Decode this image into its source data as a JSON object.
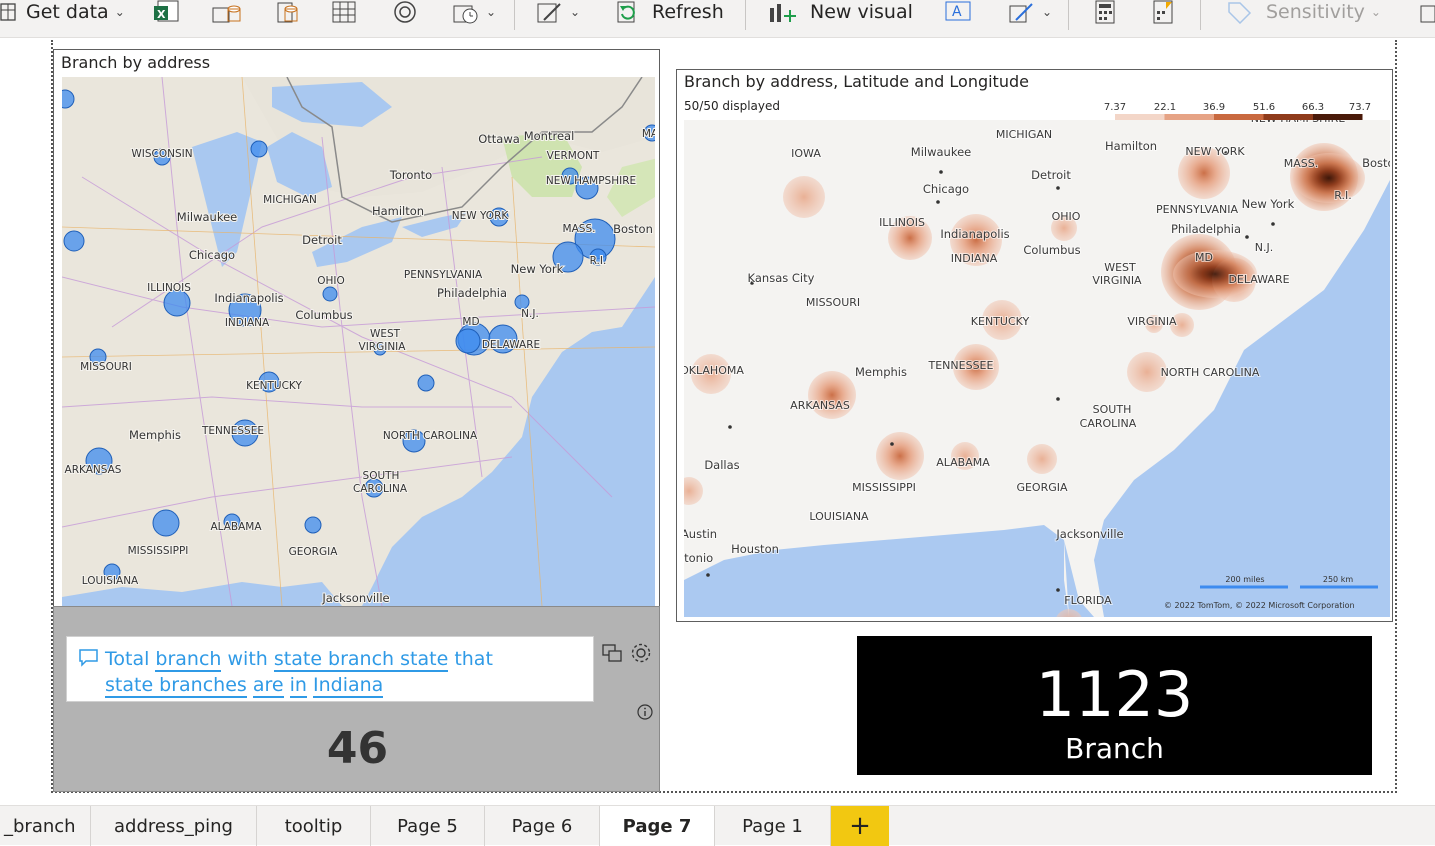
{
  "ribbon": {
    "get_data": "Get data",
    "refresh": "Refresh",
    "new_visual": "New visual",
    "sensitivity": "Sensitivity"
  },
  "visual1": {
    "title": "Branch by address",
    "labels": [
      "WISCONSIN",
      "MICHIGAN",
      "Milwaukee",
      "Chicago",
      "Detroit",
      "Toronto",
      "Hamilton",
      "Ottawa",
      "Montreal",
      "VERMONT",
      "NEW HAMPSHIRE",
      "NEW YORK",
      "MASS.",
      "Boston",
      "R.I.",
      "New York",
      "PENNSYLVANIA",
      "Philadelphia",
      "N.J.",
      "OHIO",
      "Columbus",
      "ILLINOIS",
      "Indianapolis",
      "INDIANA",
      "MISSOURI",
      "WEST",
      "VIRGINIA",
      "KENTUCKY",
      "Memphis",
      "TENNESSEE",
      "NORTH CAROLINA",
      "ARKANSAS",
      "SOUTH",
      "CAROLINA",
      "ALABAMA",
      "MISSISSIPPI",
      "GEORGIA",
      "LOUISIANA",
      "Jacksonville",
      "DELAWARE",
      "MD",
      "MA"
    ]
  },
  "visual2": {
    "title": "Branch by address, Latitude and Longitude",
    "displayed": "50/50 displayed",
    "legend_ticks": [
      "7.37",
      "22.1",
      "36.9",
      "51.6",
      "66.3",
      "73.7"
    ],
    "legend_colors": [
      "#f3d6c8",
      "#e6a385",
      "#c9693f",
      "#8f3b1b",
      "#4a1a0a"
    ],
    "labels": [
      "MICHIGAN",
      "IOWA",
      "Milwaukee",
      "Hamilton",
      "NEW YORK",
      "Boston",
      "Detroit",
      "Chicago",
      "MASS.",
      "R.I.",
      "PENNSYLVANIA",
      "New York",
      "ILLINOIS",
      "OHIO",
      "Philadelphia",
      "Indianapolis",
      "INDIANA",
      "Columbus",
      "N.J.",
      "Kansas City",
      "WEST",
      "VIRGINIA",
      "MD",
      "DELAWARE",
      "MISSOURI",
      "KENTUCKY",
      "VIRGINIA",
      "OKLAHOMA",
      "Memphis",
      "TENNESSEE",
      "NORTH CAROLINA",
      "ARKANSAS",
      "SOUTH",
      "CAROLINA",
      "Dallas",
      "ALABAMA",
      "MISSISSIPPI",
      "GEORGIA",
      "LOUISIANA",
      "Austin",
      "Houston",
      "ntonio",
      "Jacksonville",
      "FLORIDA",
      "NEW HAMPSHIRE"
    ],
    "scale_miles": "200 miles",
    "scale_km": "250 km",
    "copyright": "© 2022 TomTom, © 2022 Microsoft Corporation"
  },
  "qa": {
    "q_words": [
      "Total",
      "branch",
      "with",
      "state branch state",
      "that",
      "state branches",
      "are",
      "in",
      "Indiana"
    ],
    "value": "46"
  },
  "card": {
    "value": "1123",
    "label": "Branch"
  },
  "tabs": [
    "_branch",
    "address_ping",
    "tooltip",
    "Page 5",
    "Page 6",
    "Page 7",
    "Page 1"
  ],
  "active_tab": "Page 7",
  "colors": {
    "accent": "#2f9ae6",
    "bubble": "#3d8bef",
    "add_tab": "#f2c811",
    "card_bg": "#000000"
  }
}
